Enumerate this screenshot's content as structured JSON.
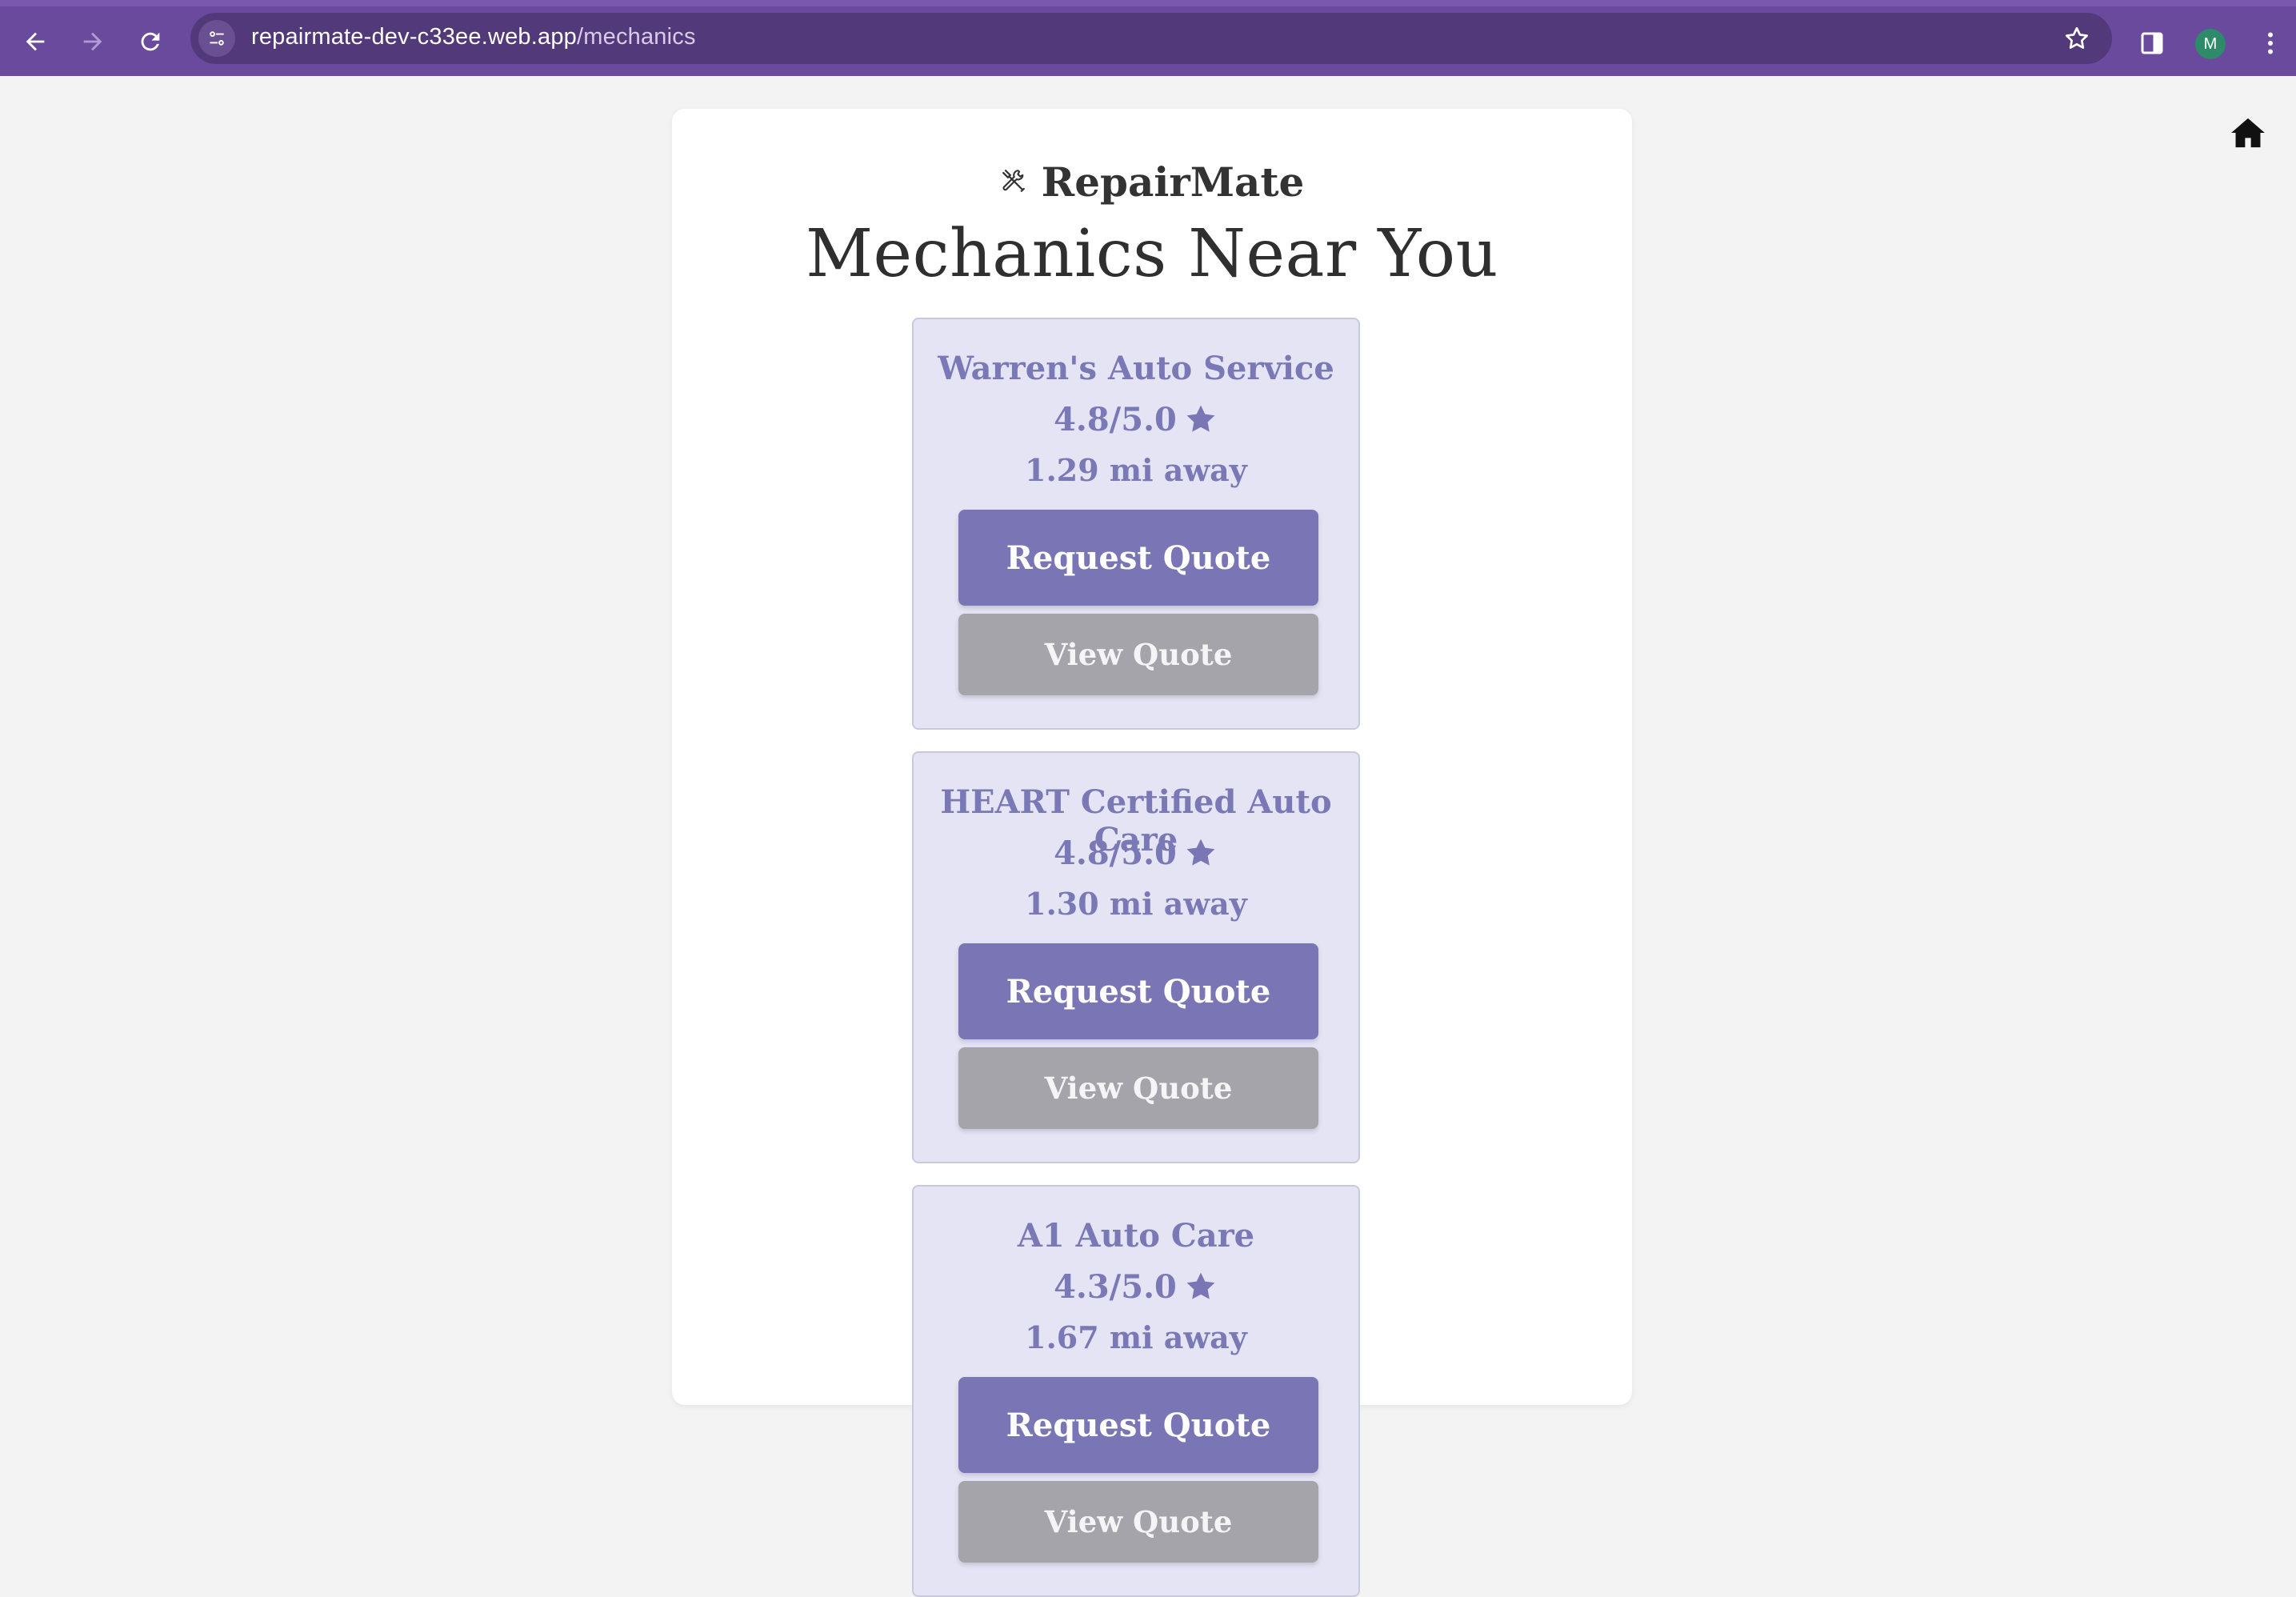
{
  "browser": {
    "url_domain": "repairmate-dev-c33ee.web.app",
    "url_path": "/mechanics",
    "profile_initial": "M",
    "icons": [
      "back-icon",
      "forward-icon",
      "reload-icon",
      "site-info-icon",
      "bookmark-star-icon",
      "side-panel-icon",
      "more-menu-icon"
    ]
  },
  "page": {
    "brand": "RepairMate",
    "brand_icon": "tools-icon",
    "title": "Mechanics Near You",
    "home_icon": "home-icon"
  },
  "mechanics": [
    {
      "name": "Warren's Auto Service",
      "rating": "4.8/5.0",
      "distance": "1.29 mi away",
      "request_label": "Request Quote",
      "view_label": "View Quote"
    },
    {
      "name": "HEART Certified Auto Care",
      "rating": "4.8/5.0",
      "distance": "1.30 mi away",
      "request_label": "Request Quote",
      "view_label": "View Quote"
    },
    {
      "name": "A1 Auto Care",
      "rating": "4.3/5.0",
      "distance": "1.67 mi away",
      "request_label": "Request Quote",
      "view_label": "View Quote"
    }
  ],
  "colors": {
    "chrome": "#6a4a9c",
    "card_bg": "#e4e4f5",
    "accent": "#7a76b5",
    "secondary_button": "#a5a4ab"
  }
}
